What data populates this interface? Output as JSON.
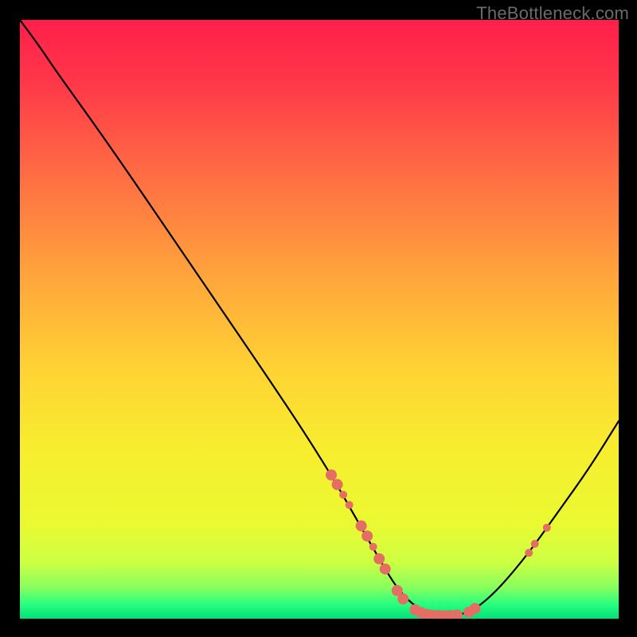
{
  "watermark": "TheBottleneck.com",
  "chart_data": {
    "type": "line",
    "title": "",
    "xlabel": "",
    "ylabel": "",
    "xlim": [
      0,
      100
    ],
    "ylim": [
      0,
      100
    ],
    "grid": false,
    "curve": {
      "name": "bottleneck-curve",
      "stroke": "#000000",
      "points": [
        {
          "x": 0,
          "y": 100
        },
        {
          "x": 3,
          "y": 96
        },
        {
          "x": 6,
          "y": 91.5
        },
        {
          "x": 15,
          "y": 79
        },
        {
          "x": 30,
          "y": 57
        },
        {
          "x": 45,
          "y": 35
        },
        {
          "x": 52,
          "y": 24
        },
        {
          "x": 56,
          "y": 17
        },
        {
          "x": 60,
          "y": 10
        },
        {
          "x": 63,
          "y": 5
        },
        {
          "x": 66,
          "y": 2
        },
        {
          "x": 69,
          "y": 0.5
        },
        {
          "x": 73,
          "y": 0.5
        },
        {
          "x": 76,
          "y": 1.5
        },
        {
          "x": 80,
          "y": 5
        },
        {
          "x": 85,
          "y": 11
        },
        {
          "x": 90,
          "y": 18
        },
        {
          "x": 95,
          "y": 25
        },
        {
          "x": 100,
          "y": 33
        }
      ]
    },
    "markers": {
      "name": "benchmark-points",
      "color": "#e46d64",
      "radius_small": 5,
      "radius_large": 7,
      "points": [
        {
          "x": 52,
          "y": 24,
          "r": "large"
        },
        {
          "x": 53,
          "y": 22.4,
          "r": "large"
        },
        {
          "x": 54,
          "y": 20.7,
          "r": "small"
        },
        {
          "x": 55,
          "y": 19,
          "r": "small"
        },
        {
          "x": 57,
          "y": 15.5,
          "r": "large"
        },
        {
          "x": 58,
          "y": 13.8,
          "r": "large"
        },
        {
          "x": 59,
          "y": 12,
          "r": "small"
        },
        {
          "x": 60,
          "y": 10,
          "r": "large"
        },
        {
          "x": 61,
          "y": 8.3,
          "r": "large"
        },
        {
          "x": 63,
          "y": 4.7,
          "r": "large"
        },
        {
          "x": 64,
          "y": 3.3,
          "r": "large"
        },
        {
          "x": 66,
          "y": 1.5,
          "r": "large"
        },
        {
          "x": 67,
          "y": 1.0,
          "r": "large"
        },
        {
          "x": 68,
          "y": 0.7,
          "r": "large"
        },
        {
          "x": 69,
          "y": 0.55,
          "r": "large"
        },
        {
          "x": 70,
          "y": 0.5,
          "r": "large"
        },
        {
          "x": 71,
          "y": 0.5,
          "r": "large"
        },
        {
          "x": 72,
          "y": 0.5,
          "r": "large"
        },
        {
          "x": 73,
          "y": 0.6,
          "r": "large"
        },
        {
          "x": 75,
          "y": 1.1,
          "r": "large"
        },
        {
          "x": 76,
          "y": 1.7,
          "r": "large"
        },
        {
          "x": 85,
          "y": 11,
          "r": "small"
        },
        {
          "x": 86,
          "y": 12.5,
          "r": "small"
        },
        {
          "x": 88,
          "y": 15.2,
          "r": "small"
        }
      ]
    },
    "background_gradient": {
      "stops": [
        {
          "offset": 0.0,
          "color": "#ff1f4a"
        },
        {
          "offset": 0.1,
          "color": "#ff3649"
        },
        {
          "offset": 0.25,
          "color": "#ff6a44"
        },
        {
          "offset": 0.42,
          "color": "#ffa23c"
        },
        {
          "offset": 0.58,
          "color": "#ffd234"
        },
        {
          "offset": 0.72,
          "color": "#f7ee2f"
        },
        {
          "offset": 0.84,
          "color": "#eaf931"
        },
        {
          "offset": 0.905,
          "color": "#ceff42"
        },
        {
          "offset": 0.948,
          "color": "#88ff5e"
        },
        {
          "offset": 0.975,
          "color": "#2bff7e"
        },
        {
          "offset": 1.0,
          "color": "#00e27a"
        }
      ]
    }
  }
}
